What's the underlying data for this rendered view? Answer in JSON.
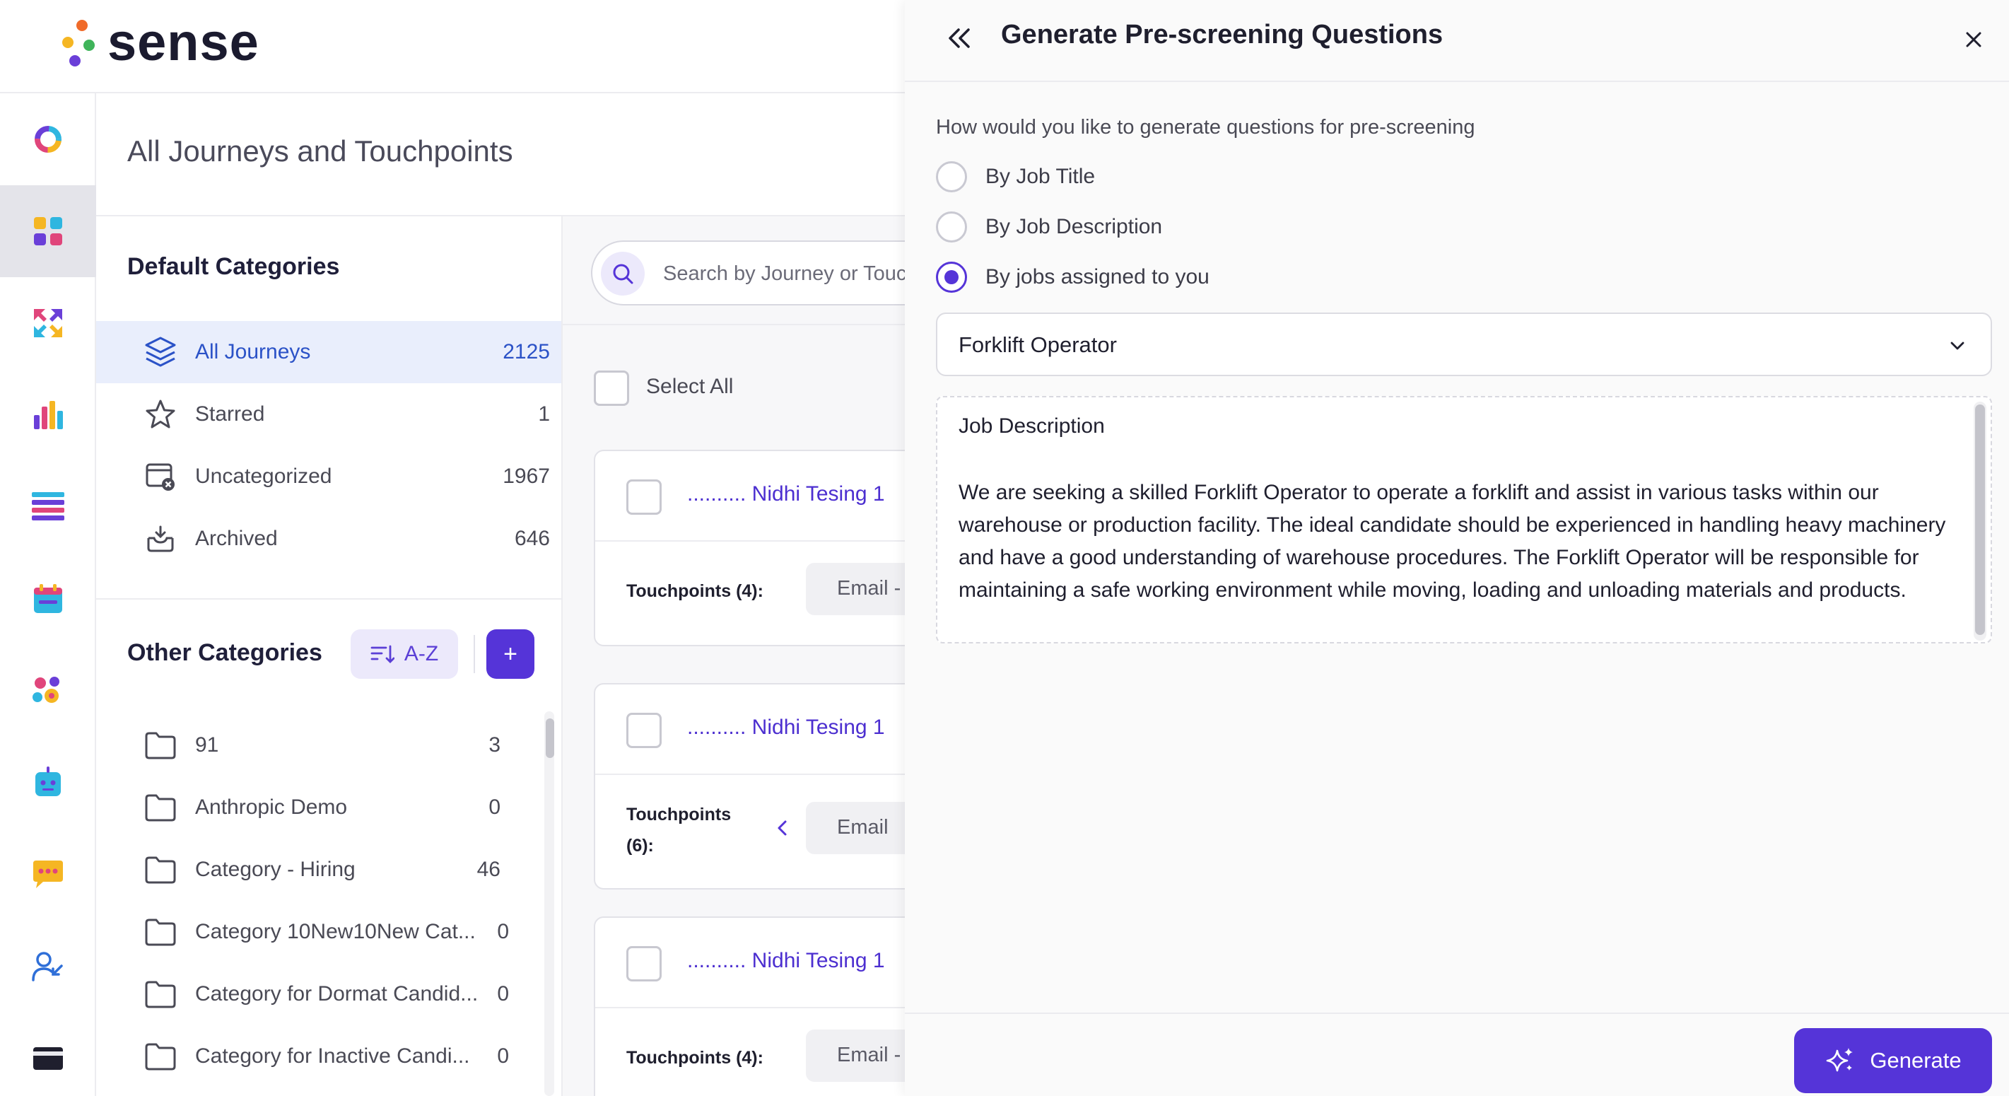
{
  "app": {
    "name": "sense"
  },
  "page": {
    "title": "All Journeys and Touchpoints"
  },
  "default_categories": {
    "heading": "Default Categories",
    "items": [
      {
        "label": "All Journeys",
        "count": "2125",
        "icon": "layers-icon",
        "active": true
      },
      {
        "label": "Starred",
        "count": "1",
        "icon": "star-icon"
      },
      {
        "label": "Uncategorized",
        "count": "1967",
        "icon": "uncategorized-icon"
      },
      {
        "label": "Archived",
        "count": "646",
        "icon": "archive-icon"
      }
    ]
  },
  "other_categories": {
    "heading": "Other Categories",
    "sort_label": "A-Z",
    "add_label": "+",
    "items": [
      {
        "label": "91",
        "count": "3"
      },
      {
        "label": "Anthropic Demo",
        "count": "0"
      },
      {
        "label": "Category - Hiring",
        "count": "46"
      },
      {
        "label": "Category 10New10New Cat...",
        "count": "0"
      },
      {
        "label": "Category for Dormat Candid...",
        "count": "0"
      },
      {
        "label": "Category for Inactive Candi...",
        "count": "0"
      }
    ]
  },
  "journeys": {
    "search_placeholder": "Search by Journey or Touchpoint",
    "select_all_label": "Select All",
    "cards": [
      {
        "title": ".......... Nidhi Tesing 1",
        "touchpoints_label": "Touchpoints (4):",
        "chip": "Email - "
      },
      {
        "title": ".......... Nidhi Tesing 1",
        "touchpoints_label": "Touchpoints (6):",
        "chip": "Email"
      },
      {
        "title": ".......... Nidhi Tesing 1",
        "touchpoints_label": "Touchpoints (4):",
        "chip": "Email - "
      }
    ]
  },
  "drawer": {
    "title": "Generate Pre-screening Questions",
    "prompt": "How would you like to generate questions for pre-screening",
    "options": [
      {
        "label": "By Job Title",
        "checked": false
      },
      {
        "label": "By Job Description",
        "checked": false
      },
      {
        "label": "By jobs assigned to you",
        "checked": true
      }
    ],
    "selected_job": "Forklift Operator",
    "job_description_heading": "Job Description",
    "job_description_text": "We are seeking a skilled Forklift Operator to operate a forklift and assist in various tasks within our warehouse or production facility. The ideal candidate should be experienced in handling heavy machinery and have a good understanding of warehouse procedures. The Forklift Operator will be responsible for maintaining a safe working environment while moving, loading and unloading materials and products.",
    "generate_label": "Generate"
  },
  "colors": {
    "primary": "#5534d8",
    "active_link": "#2b52c7",
    "active_row_bg": "#e9eefc"
  }
}
